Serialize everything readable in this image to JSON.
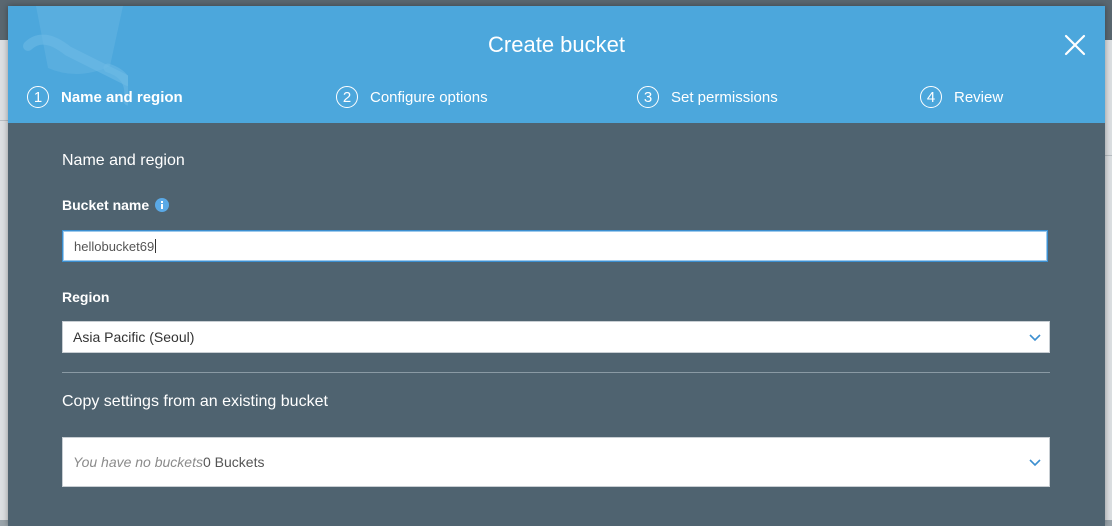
{
  "modal": {
    "title": "Create bucket"
  },
  "steps": [
    {
      "number": "1",
      "label": "Name and region",
      "active": true
    },
    {
      "number": "2",
      "label": "Configure options",
      "active": false
    },
    {
      "number": "3",
      "label": "Set permissions",
      "active": false
    },
    {
      "number": "4",
      "label": "Review",
      "active": false
    }
  ],
  "form": {
    "section_title": "Name and region",
    "bucket_name_label": "Bucket name",
    "bucket_name_value": "hellobucket69",
    "region_label": "Region",
    "region_value": "Asia Pacific (Seoul)",
    "copy_title": "Copy settings from an existing bucket",
    "copy_placeholder": "You have no buckets",
    "copy_count": "0 Buckets"
  },
  "colors": {
    "header": "#4ca7dc",
    "body": "#4f6370",
    "input_focus": "#3c8fd0",
    "info_icon": "#5aa9e6"
  },
  "icons": {
    "close": "close-icon",
    "info": "info-icon",
    "dropdown": "chevron-down-icon"
  }
}
